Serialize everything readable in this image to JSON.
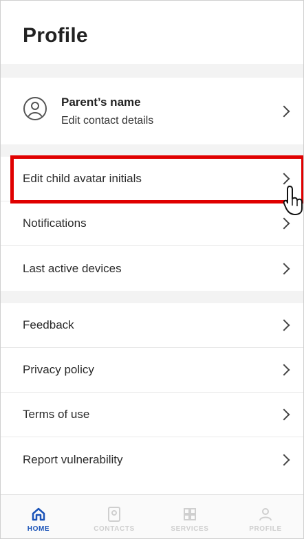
{
  "header": {
    "title": "Profile"
  },
  "profile": {
    "name": "Parent’s name",
    "subtitle": "Edit contact details"
  },
  "group1": [
    {
      "label": "Edit child avatar initials"
    },
    {
      "label": "Notifications"
    },
    {
      "label": "Last active devices"
    }
  ],
  "group2": [
    {
      "label": "Feedback"
    },
    {
      "label": "Privacy policy"
    },
    {
      "label": "Terms of use"
    },
    {
      "label": "Report vulnerability"
    }
  ],
  "tabs": [
    {
      "label": "HOME",
      "icon": "home-icon",
      "active": true
    },
    {
      "label": "CONTACTS",
      "icon": "contacts-icon",
      "active": false
    },
    {
      "label": "SERVICES",
      "icon": "services-icon",
      "active": false
    },
    {
      "label": "PROFILE",
      "icon": "profile-icon",
      "active": false
    }
  ],
  "colors": {
    "highlight": "#e00000",
    "active_tab": "#1a53b8",
    "inactive_tab": "#cfcfcf",
    "section_gap": "#f3f3f3"
  }
}
